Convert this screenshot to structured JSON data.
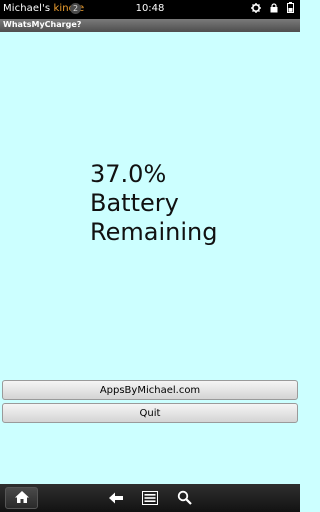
{
  "status_bar": {
    "device_owner": "Michael's",
    "device_brand": "kindle",
    "notification_count": "2",
    "time": "10:48",
    "icons": [
      "settings-gear-icon",
      "lock-icon",
      "battery-icon"
    ]
  },
  "app": {
    "title": "WhatsMyCharge?"
  },
  "main": {
    "charge_percent": "37.0%",
    "line2": "Battery",
    "line3": "Remaining"
  },
  "buttons": {
    "apps_by_michael": "AppsByMichael.com",
    "quit": "Quit"
  },
  "nav_bar": {
    "icons": [
      "home-icon",
      "back-arrow-icon",
      "menu-icon",
      "search-icon"
    ]
  },
  "colors": {
    "background": "#ccffff",
    "brand": "#f0a030"
  }
}
